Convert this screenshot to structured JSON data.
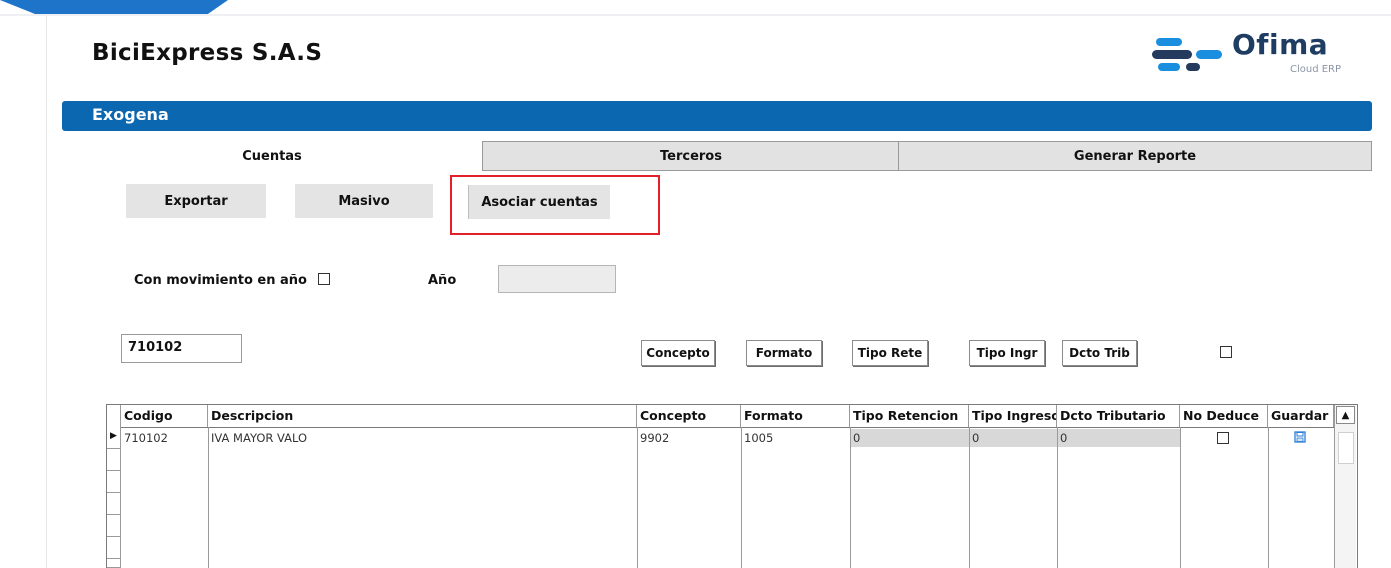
{
  "app": {
    "company": "BiciExpress S.A.S",
    "logo_name": "Ofima",
    "logo_sub": "Cloud ERP",
    "module_title": "Exogena"
  },
  "tabs": [
    {
      "label": "Cuentas",
      "active": true
    },
    {
      "label": "Terceros",
      "active": false
    },
    {
      "label": "Generar Reporte",
      "active": false
    }
  ],
  "actions": {
    "exportar": "Exportar",
    "masivo": "Masivo",
    "asociar": "Asociar cuentas"
  },
  "filters": {
    "movimiento_label": "Con movimiento en año",
    "movimiento_checked": false,
    "year_label": "Año",
    "year_value": ""
  },
  "search": {
    "code_value": "710102"
  },
  "field_buttons": [
    "Concepto",
    "Formato",
    "Tipo Rete",
    "Tipo Ingr",
    "Dcto Trib"
  ],
  "grid": {
    "columns": [
      "Codigo",
      "Descripcion",
      "Concepto",
      "Formato",
      "Tipo Retencion",
      "Tipo Ingreso",
      "Dcto Tributario",
      "No Deduce",
      "Guardar"
    ],
    "rows": [
      {
        "codigo": "710102",
        "descripcion": "IVA MAYOR VALO",
        "concepto": "9902",
        "formato": "1005",
        "tipo_retencion": "0",
        "tipo_ingreso": "0",
        "dcto_tributario": "0",
        "no_deduce": false,
        "guardar_icon": "save-icon"
      }
    ]
  },
  "colors": {
    "module_bar": "#0b67b0",
    "highlight": "#e3202a",
    "logo_text": "#1f3d63",
    "logo_blue": "#1a8fe0",
    "logo_dark": "#243b5e"
  }
}
